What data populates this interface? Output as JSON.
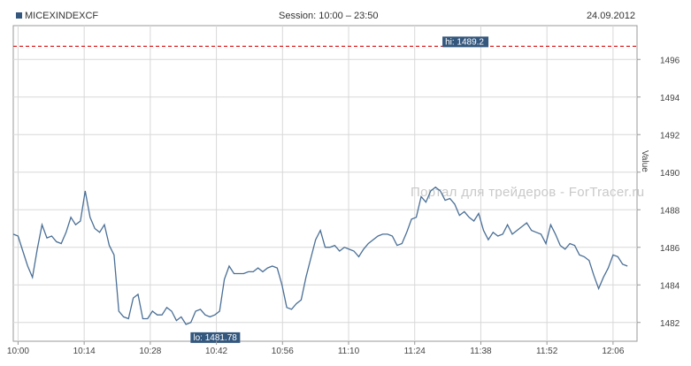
{
  "header": {
    "symbol": "MICEXINDEXCF",
    "session": "Session: 10:00 – 23:50",
    "date": "24.09.2012"
  },
  "watermark": "Портал для трейдеров - ForTracer.ru",
  "colors": {
    "line": "#4a6f96",
    "hi_line": "#dd2222",
    "label_bg": "#34577d",
    "grid": "#d8d8d8",
    "border": "#999999",
    "legend_square": "#34577d"
  },
  "chart_data": {
    "type": "line",
    "title": "MICEXINDEXCF",
    "xlabel": "",
    "ylabel": "Value",
    "x_ticks": [
      "10:00",
      "10:14",
      "10:28",
      "10:42",
      "10:56",
      "11:10",
      "11:24",
      "11:38",
      "11:52",
      "12:06"
    ],
    "y_ticks": [
      1482,
      1484,
      1486,
      1488,
      1490,
      1492,
      1494,
      1496
    ],
    "ylim": [
      1481.0,
      1497.8
    ],
    "xlim": [
      0,
      130
    ],
    "hi": {
      "label": "hi: 1489.2",
      "value": 1496.7,
      "x": 90
    },
    "lo": {
      "label": "lo: 1481.78",
      "x": 37.5
    },
    "grid": true,
    "x": [
      0,
      1,
      2,
      3,
      4,
      5,
      6,
      7,
      8,
      9,
      10,
      11,
      12,
      13,
      14,
      15,
      16,
      17,
      18,
      19,
      20,
      21,
      22,
      23,
      24,
      25,
      26,
      27,
      28,
      29,
      30,
      31,
      32,
      33,
      34,
      35,
      36,
      37,
      38,
      39,
      40,
      41,
      42,
      43,
      44,
      45,
      46,
      47,
      48,
      49,
      50,
      51,
      52,
      53,
      54,
      55,
      56,
      57,
      58,
      59,
      60,
      61,
      62,
      63,
      64,
      65,
      66,
      67,
      68,
      69,
      70,
      71,
      72,
      73,
      74,
      75,
      76,
      77,
      78,
      79,
      80,
      81,
      82,
      83,
      84,
      85,
      86,
      87,
      88,
      89,
      90,
      91,
      92,
      93,
      94,
      95,
      96,
      97,
      98,
      99,
      100,
      101,
      102,
      103,
      104,
      105,
      106,
      107,
      108,
      109,
      110,
      111,
      112,
      113,
      114,
      115,
      116,
      117,
      118,
      119,
      120,
      121,
      122,
      123,
      124,
      125,
      126,
      127,
      128
    ],
    "values": [
      1486.7,
      1486.6,
      1485.8,
      1485.0,
      1484.4,
      1485.9,
      1487.2,
      1486.5,
      1486.6,
      1486.3,
      1486.2,
      1486.8,
      1487.6,
      1487.2,
      1487.4,
      1489.0,
      1487.6,
      1487.0,
      1486.8,
      1487.2,
      1486.1,
      1485.6,
      1482.6,
      1482.3,
      1482.2,
      1483.3,
      1483.5,
      1482.2,
      1482.2,
      1482.6,
      1482.4,
      1482.4,
      1482.8,
      1482.6,
      1482.1,
      1482.3,
      1481.9,
      1482.0,
      1482.6,
      1482.7,
      1482.4,
      1482.3,
      1482.4,
      1482.6,
      1484.3,
      1485.0,
      1484.6,
      1484.6,
      1484.6,
      1484.7,
      1484.7,
      1484.9,
      1484.7,
      1484.9,
      1485.0,
      1484.9,
      1484.0,
      1482.8,
      1482.7,
      1483.0,
      1483.2,
      1484.4,
      1485.4,
      1486.4,
      1486.9,
      1486.0,
      1486.0,
      1486.1,
      1485.8,
      1486.0,
      1485.9,
      1485.8,
      1485.5,
      1485.9,
      1486.2,
      1486.4,
      1486.6,
      1486.7,
      1486.7,
      1486.6,
      1486.1,
      1486.2,
      1486.8,
      1487.5,
      1487.6,
      1488.7,
      1488.4,
      1489.0,
      1489.2,
      1489.0,
      1488.5,
      1488.6,
      1488.3,
      1487.7,
      1487.9,
      1487.6,
      1487.4,
      1487.8,
      1486.9,
      1486.4,
      1486.8,
      1486.6,
      1486.7,
      1487.2,
      1486.7,
      1486.9,
      1487.1,
      1487.3,
      1486.9,
      1486.8,
      1486.7,
      1486.2,
      1487.2,
      1486.7,
      1486.1,
      1485.9,
      1486.2,
      1486.1,
      1485.6,
      1485.5,
      1485.3,
      1484.5,
      1483.8,
      1484.4,
      1484.9,
      1485.6,
      1485.5,
      1485.1,
      1485.0
    ]
  }
}
